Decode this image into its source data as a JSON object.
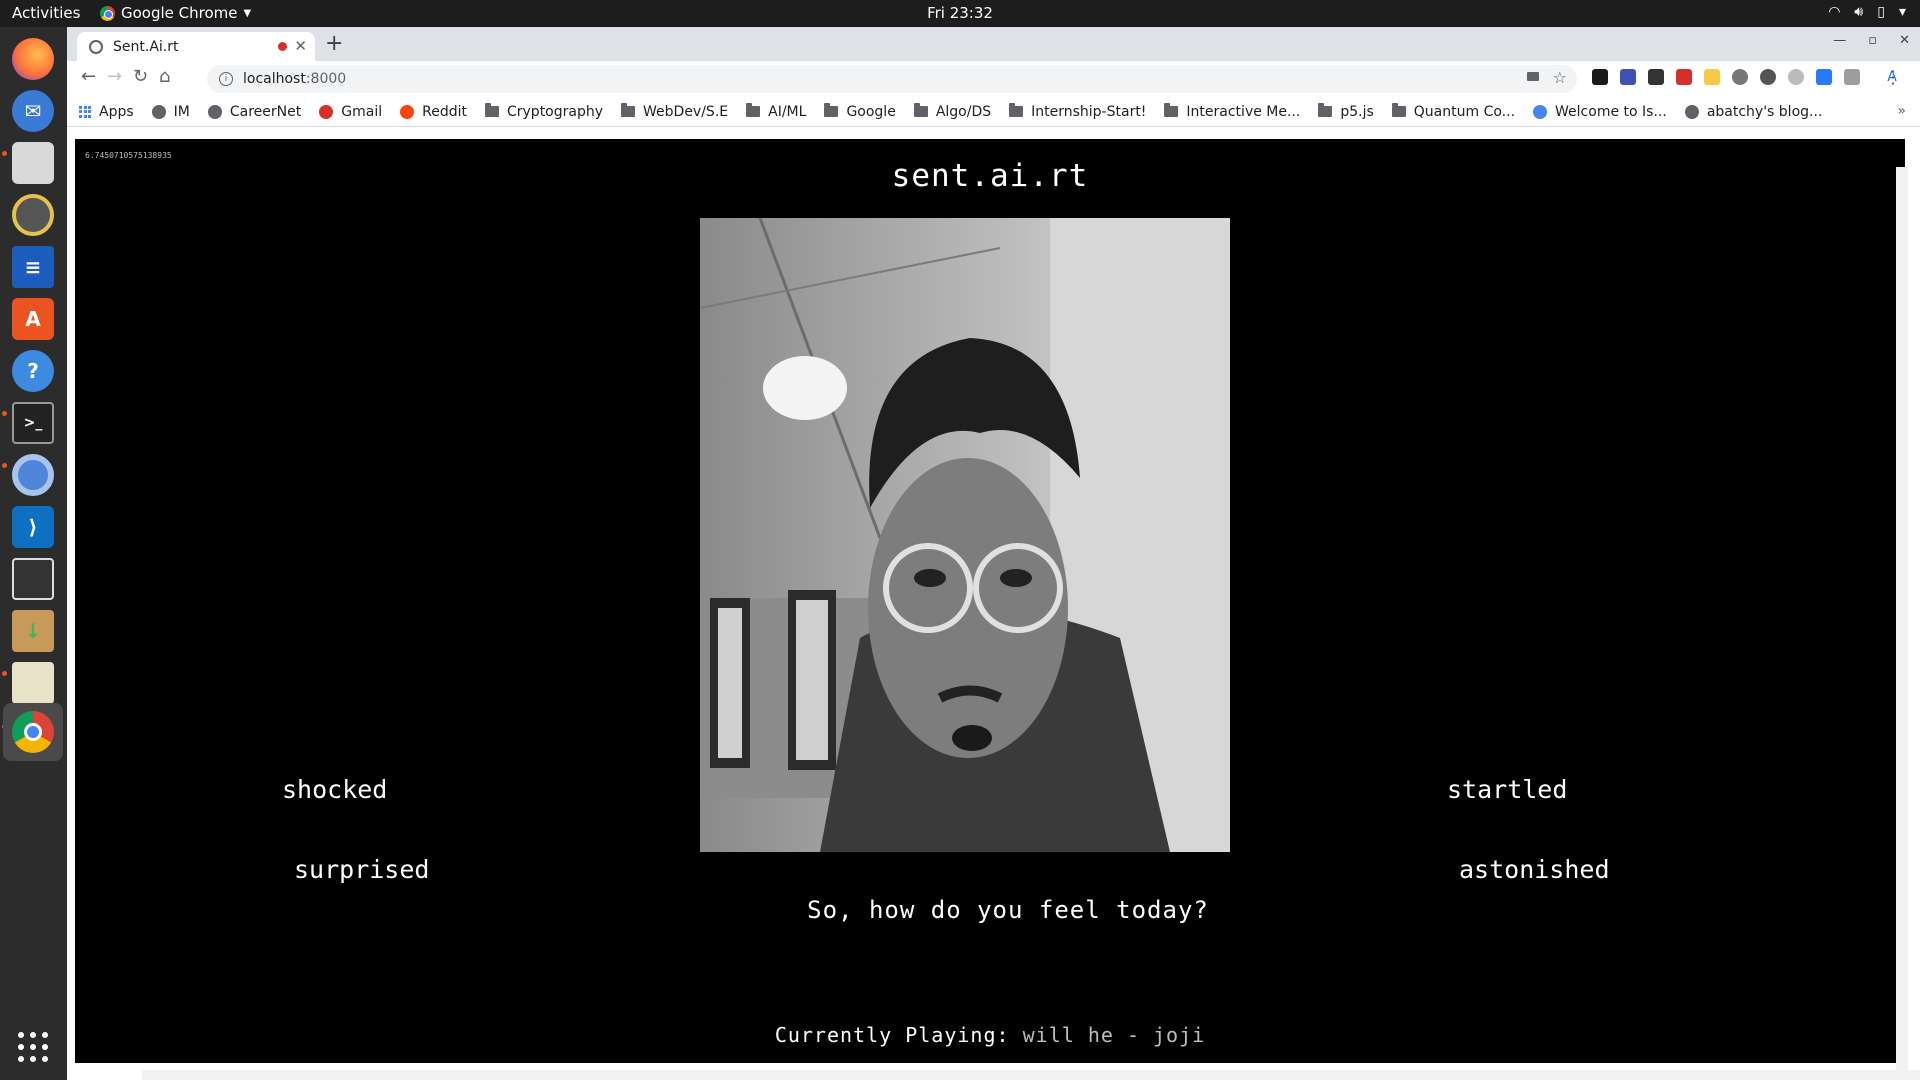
{
  "topbar": {
    "activities": "Activities",
    "app_name": "Google Chrome",
    "clock": "Fri 23:32"
  },
  "browser": {
    "tab_title": "Sent.Ai.rt",
    "url_host": "localhost",
    "url_port": ":8000",
    "bookmarks": [
      {
        "label": "Apps",
        "icon": "apps-icon"
      },
      {
        "label": "IM",
        "icon": "site-icon"
      },
      {
        "label": "CareerNet",
        "icon": "site-icon"
      },
      {
        "label": "Gmail",
        "icon": "gmail-icon"
      },
      {
        "label": "Reddit",
        "icon": "reddit-icon"
      },
      {
        "label": "Cryptography",
        "icon": "folder-icon"
      },
      {
        "label": "WebDev/S.E",
        "icon": "folder-icon"
      },
      {
        "label": "AI/ML",
        "icon": "folder-icon"
      },
      {
        "label": "Google",
        "icon": "folder-icon"
      },
      {
        "label": "Algo/DS",
        "icon": "folder-icon"
      },
      {
        "label": "Internship-Start!",
        "icon": "folder-icon"
      },
      {
        "label": "Interactive Me...",
        "icon": "folder-icon"
      },
      {
        "label": "p5.js",
        "icon": "folder-icon"
      },
      {
        "label": "Quantum Co...",
        "icon": "folder-icon"
      },
      {
        "label": "Welcome to Is...",
        "icon": "bulb-icon"
      },
      {
        "label": "abatchy's blog...",
        "icon": "site-icon"
      }
    ]
  },
  "page": {
    "fps_readout": "6.7450710575138935",
    "title": "sent.ai.rt",
    "emotions": {
      "top_left": "shocked",
      "bottom_left": "surprised",
      "top_right": "startled",
      "bottom_right": "astonished"
    },
    "question": "So, how do you feel today?",
    "playing_label": "Currently Playing:",
    "song": "will he - joji"
  },
  "colors": {
    "page_background": "#000000",
    "ubuntu_accent": "#e95420",
    "recording_dot": "#d93025"
  }
}
